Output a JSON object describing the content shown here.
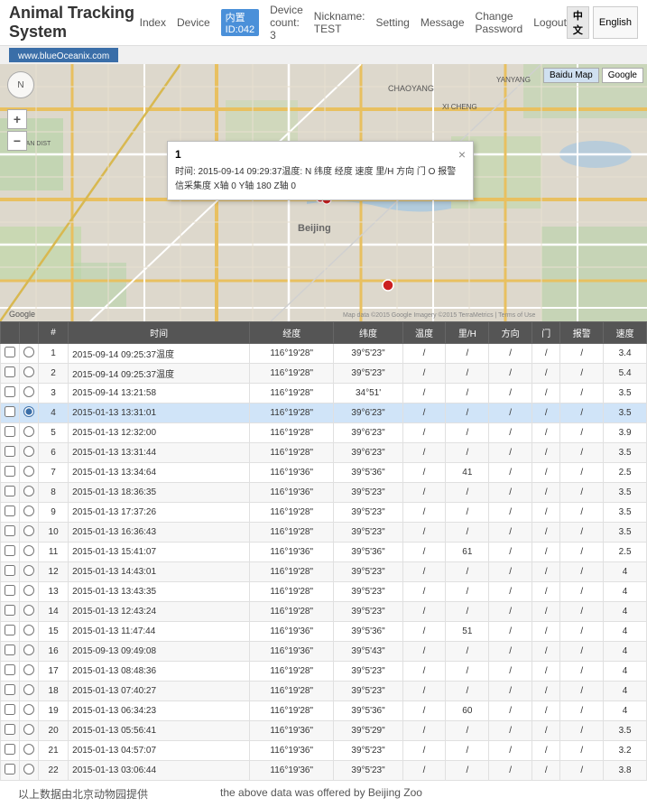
{
  "header": {
    "title": "Animal Tracking System",
    "website": "www.blueOceanix.com",
    "nav": [
      "Index",
      "Device",
      "Device count: 3",
      "Nickname: TEST",
      "Setting",
      "Message",
      "Change Password",
      "Logout"
    ],
    "device_label": "Device：",
    "device_id": "内置ID:042",
    "lang_zh": "中文",
    "lang_en": "English"
  },
  "map": {
    "baidu_btn": "Baidu Map",
    "google_btn": "Google",
    "popup": {
      "num": "1",
      "close": "×",
      "content": "时间: 2015-09-14 09:29:37温度: N 纬度 经度 速度 里/H 方向 门 O 报警 信采集度 X轴 0 Y轴 180 Z轴 0"
    }
  },
  "table": {
    "columns": [
      "",
      "",
      "#",
      "时间",
      "经度",
      "纬度",
      "温度",
      "里/H",
      "方向",
      "门",
      "报警",
      "速度"
    ],
    "rows": [
      {
        "num": 1,
        "time": "2015-09-14 09:25:37温度",
        "lng": "116°19'28\"",
        "lat": "39°5'23\"",
        "temp": "/",
        "speed": "/",
        "dir": "/",
        "door": "/",
        "alarm": "/",
        "val": "3.4"
      },
      {
        "num": 2,
        "time": "2015-09-14 09:25:37温度",
        "lng": "116°19'28\"",
        "lat": "39°5'23\"",
        "temp": "/",
        "speed": "/",
        "dir": "/",
        "door": "/",
        "alarm": "/",
        "val": "5.4"
      },
      {
        "num": 3,
        "time": "2015-09-14 13:21:58",
        "lng": "116°19'28\"",
        "lat": "34°51'",
        "temp": "/",
        "speed": "/",
        "dir": "/",
        "door": "/",
        "alarm": "/",
        "val": "3.5"
      },
      {
        "num": 4,
        "time": "2015-01-13 13:31:01",
        "lng": "116°19'28\"",
        "lat": "39°6'23\"",
        "temp": "/",
        "speed": "/",
        "dir": "/",
        "door": "/",
        "alarm": "/",
        "val": "3.5"
      },
      {
        "num": 5,
        "time": "2015-01-13 12:32:00",
        "lng": "116°19'28\"",
        "lat": "39°6'23\"",
        "temp": "/",
        "speed": "/",
        "dir": "/",
        "door": "/",
        "alarm": "/",
        "val": "3.9"
      },
      {
        "num": 6,
        "time": "2015-01-13 13:31:44",
        "lng": "116°19'28\"",
        "lat": "39°6'23\"",
        "temp": "/",
        "speed": "/",
        "dir": "/",
        "door": "/",
        "alarm": "/",
        "val": "3.5"
      },
      {
        "num": 7,
        "time": "2015-01-13 13:34:64",
        "lng": "116°19'36\"",
        "lat": "39°5'36\"",
        "temp": "/",
        "speed": "41",
        "dir": "/",
        "door": "/",
        "alarm": "/",
        "val": "2.5"
      },
      {
        "num": 8,
        "time": "2015-01-13 18:36:35",
        "lng": "116°19'36\"",
        "lat": "39°5'23\"",
        "temp": "/",
        "speed": "/",
        "dir": "/",
        "door": "/",
        "alarm": "/",
        "val": "3.5"
      },
      {
        "num": 9,
        "time": "2015-01-13 17:37:26",
        "lng": "116°19'28\"",
        "lat": "39°5'23\"",
        "temp": "/",
        "speed": "/",
        "dir": "/",
        "door": "/",
        "alarm": "/",
        "val": "3.5"
      },
      {
        "num": 10,
        "time": "2015-01-13 16:36:43",
        "lng": "116°19'28\"",
        "lat": "39°5'23\"",
        "temp": "/",
        "speed": "/",
        "dir": "/",
        "door": "/",
        "alarm": "/",
        "val": "3.5"
      },
      {
        "num": 11,
        "time": "2015-01-13 15:41:07",
        "lng": "116°19'36\"",
        "lat": "39°5'36\"",
        "temp": "/",
        "speed": "61",
        "dir": "/",
        "door": "/",
        "alarm": "/",
        "val": "2.5"
      },
      {
        "num": 12,
        "time": "2015-01-13 14:43:01",
        "lng": "116°19'28\"",
        "lat": "39°5'23\"",
        "temp": "/",
        "speed": "/",
        "dir": "/",
        "door": "/",
        "alarm": "/",
        "val": "4"
      },
      {
        "num": 13,
        "time": "2015-01-13 13:43:35",
        "lng": "116°19'28\"",
        "lat": "39°5'23\"",
        "temp": "/",
        "speed": "/",
        "dir": "/",
        "door": "/",
        "alarm": "/",
        "val": "4"
      },
      {
        "num": 14,
        "time": "2015-01-13 12:43:24",
        "lng": "116°19'28\"",
        "lat": "39°5'23\"",
        "temp": "/",
        "speed": "/",
        "dir": "/",
        "door": "/",
        "alarm": "/",
        "val": "4"
      },
      {
        "num": 15,
        "time": "2015-01-13 11:47:44",
        "lng": "116°19'36\"",
        "lat": "39°5'36\"",
        "temp": "/",
        "speed": "51",
        "dir": "/",
        "door": "/",
        "alarm": "/",
        "val": "4"
      },
      {
        "num": 16,
        "time": "2015-09-13 09:49:08",
        "lng": "116°19'36\"",
        "lat": "39°5'43\"",
        "temp": "/",
        "speed": "/",
        "dir": "/",
        "door": "/",
        "alarm": "/",
        "val": "4"
      },
      {
        "num": 17,
        "time": "2015-01-13 08:48:36",
        "lng": "116°19'28\"",
        "lat": "39°5'23\"",
        "temp": "/",
        "speed": "/",
        "dir": "/",
        "door": "/",
        "alarm": "/",
        "val": "4"
      },
      {
        "num": 18,
        "time": "2015-01-13 07:40:27",
        "lng": "116°19'28\"",
        "lat": "39°5'23\"",
        "temp": "/",
        "speed": "/",
        "dir": "/",
        "door": "/",
        "alarm": "/",
        "val": "4"
      },
      {
        "num": 19,
        "time": "2015-01-13 06:34:23",
        "lng": "116°19'28\"",
        "lat": "39°5'36\"",
        "temp": "/",
        "speed": "60",
        "dir": "/",
        "door": "/",
        "alarm": "/",
        "val": "4"
      },
      {
        "num": 20,
        "time": "2015-01-13 05:56:41",
        "lng": "116°19'36\"",
        "lat": "39°5'29\"",
        "temp": "/",
        "speed": "/",
        "dir": "/",
        "door": "/",
        "alarm": "/",
        "val": "3.5"
      },
      {
        "num": 21,
        "time": "2015-01-13 04:57:07",
        "lng": "116°19'36\"",
        "lat": "39°5'23\"",
        "temp": "/",
        "speed": "/",
        "dir": "/",
        "door": "/",
        "alarm": "/",
        "val": "3.2"
      },
      {
        "num": 22,
        "time": "2015-01-13 03:06:44",
        "lng": "116°19'36\"",
        "lat": "39°5'23\"",
        "temp": "/",
        "speed": "/",
        "dir": "/",
        "door": "/",
        "alarm": "/",
        "val": "3.8"
      }
    ]
  },
  "footer": {
    "zh": "以上数据由北京动物园提供",
    "en": "the above data was offered by Beijing Zoo"
  }
}
